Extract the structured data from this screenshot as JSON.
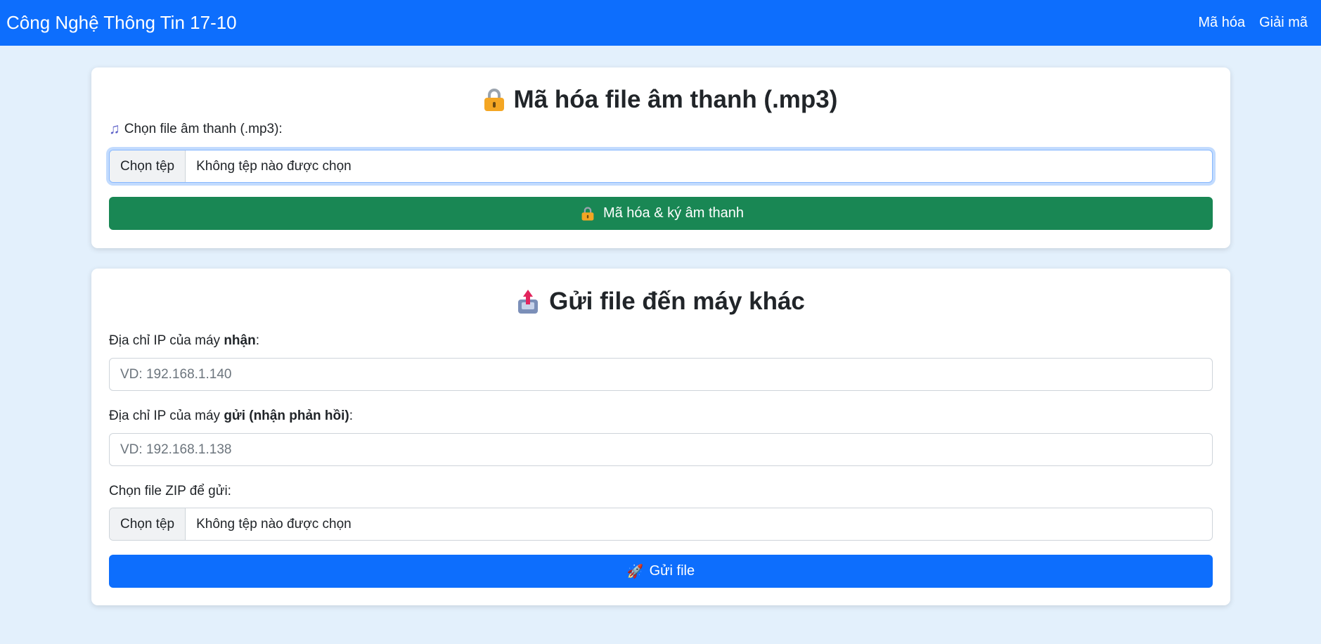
{
  "navbar": {
    "brand": "Công Nghệ Thông Tin 17-10",
    "links": [
      "Mã hóa",
      "Giải mã"
    ]
  },
  "encrypt_card": {
    "title": "Mã hóa file âm thanh (.mp3)",
    "title_icon": "lock-icon",
    "file_label": "Chọn file âm thanh (.mp3):",
    "file_label_icon": "music-note-icon",
    "file_button": "Chọn tệp",
    "file_status": "Không tệp nào được chọn",
    "submit_label": "Mã hóa & ký âm thanh",
    "submit_icon": "lock-icon",
    "submit_color": "#198754"
  },
  "send_card": {
    "title": "Gửi file đến máy khác",
    "title_icon": "outbox-tray-icon",
    "receiver_label_prefix": "Địa chỉ IP của máy ",
    "receiver_label_bold": "nhận",
    "receiver_label_suffix": ":",
    "receiver_placeholder": "VD: 192.168.1.140",
    "sender_label_prefix": "Địa chỉ IP của máy ",
    "sender_label_bold": "gửi (nhận phản hồi)",
    "sender_label_suffix": ":",
    "sender_placeholder": "VD: 192.168.1.138",
    "zip_label": "Chọn file ZIP để gửi:",
    "file_button": "Chọn tệp",
    "file_status": "Không tệp nào được chọn",
    "submit_label": "Gửi file",
    "submit_icon": "rocket-icon",
    "submit_color": "#0d6efd"
  },
  "colors": {
    "navbar": "#0d6efd",
    "page_background": "#e3f0fc"
  }
}
